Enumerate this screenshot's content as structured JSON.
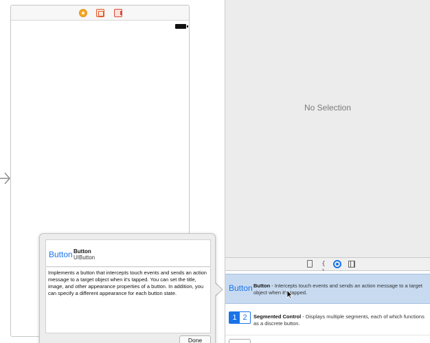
{
  "canvas": {
    "scene_dock": {
      "icons": [
        "view-controller-icon",
        "first-responder-icon",
        "exit-icon"
      ]
    }
  },
  "inspector": {
    "placeholder": "No Selection"
  },
  "library": {
    "tabs": [
      "file-template-icon",
      "code-snippet-icon",
      "object-library-icon",
      "media-library-icon"
    ],
    "items": [
      {
        "thumb": "Button",
        "name": "Button",
        "desc": " - Intercepts touch events and sends an action message to a target object when it's tapped."
      },
      {
        "thumb_left": "1",
        "thumb_right": "2",
        "name": "Segmented Control",
        "desc": " - Displays multiple segments, each of which functions as a discrete button."
      }
    ]
  },
  "popover": {
    "thumb": "Button",
    "title": "Button",
    "class_name": "UIButton",
    "description": "Implements a button that intercepts touch events and sends an action message to a target object when it's tapped. You can set the title, image, and other appearance properties of a button. In addition, you can specify a different appearance for each button state.",
    "done_label": "Done"
  },
  "colors": {
    "accent": "#1a73e8",
    "selection": "#c7daf0",
    "inspector_bg": "#ececec"
  }
}
